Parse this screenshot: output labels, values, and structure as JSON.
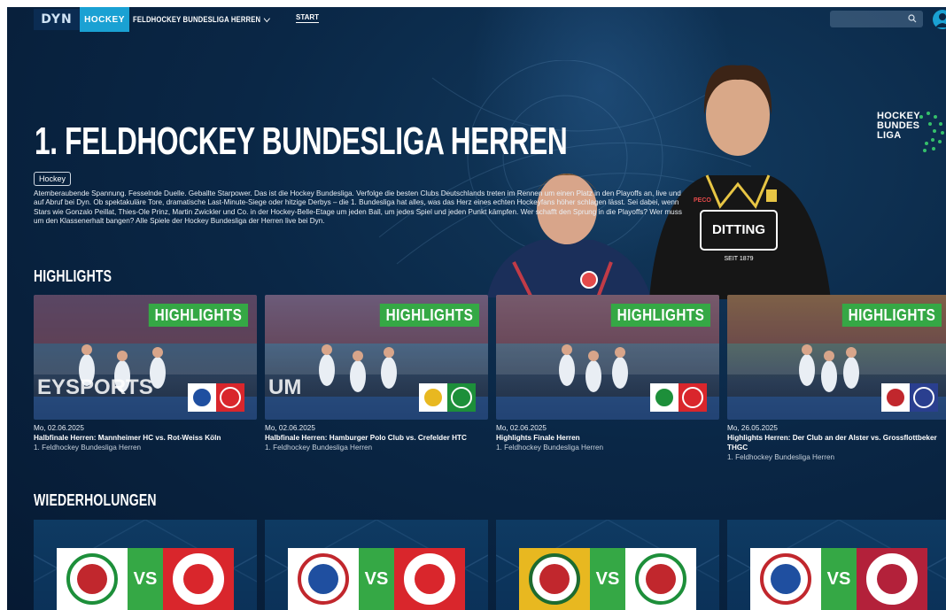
{
  "nav": {
    "logo": "DYN",
    "sport_tab": "HOCKEY",
    "league_select": "FELDHOCKEY BUNDESLIGA HERREN",
    "start_link": "START",
    "search_placeholder": ""
  },
  "hero": {
    "title": "1. FELDHOCKEY BUNDESLIGA HERREN",
    "tag": "Hockey",
    "description": "Atemberaubende Spannung. Fesselnde Duelle. Geballte Starpower. Das ist die Hockey Bundesliga. Verfolge die besten Clubs Deutschlands treten im Rennen um einen Platz in den Playoffs an, live und auf Abruf bei Dyn. Ob spektakuläre Tore, dramatische Last-Minute-Siege oder hitzige Derbys – die 1. Bundesliga hat alles, was das Herz eines echten Hockeyfans höher schlagen lässt. Sei dabei, wenn Stars wie Gonzalo Peillat, Thies-Ole Prinz, Martin Zwickler und Co. in der Hockey-Belle-Etage um jeden Ball, um jedes Spiel und jeden Punkt kämpfen. Wer schafft den Sprung in die Playoffs? Wer muss um den Klassenerhalt bangen? Alle Spiele der Hockey Bundesliga der Herren live bei Dyn.",
    "league_logo_text": [
      "HOCKEY",
      "BUNDES",
      "LIGA"
    ],
    "sponsor_text": "DITTING",
    "sponsor_sub": "SEIT 1879",
    "shirt_brand": "PECO"
  },
  "highlights": {
    "title": "HIGHLIGHTS",
    "badge": "HIGHLIGHTS",
    "items": [
      {
        "date": "Mo, 02.06.2025",
        "title": "Halbfinale Herren: Mannheimer HC vs. Rot-Weiss Köln",
        "subtitle": "1. Feldhockey Bundesliga Herren",
        "bg": "#1f4d7a",
        "crest_left": "#1f4fa0",
        "crest_right": "#d9262c",
        "watermark": "EYSPORTS"
      },
      {
        "date": "Mo, 02.06.2025",
        "title": "Halbfinale Herren: Hamburger Polo Club vs. Crefelder HTC",
        "subtitle": "1. Feldhockey Bundesliga Herren",
        "bg": "#3a6c9a",
        "crest_left": "#e8b820",
        "crest_right": "#1d8f3a",
        "watermark": "UM"
      },
      {
        "date": "Mo, 02.06.2025",
        "title": "Highlights Finale Herren",
        "subtitle": "1. Feldhockey Bundesliga Herren",
        "bg": "#4b6a86",
        "crest_left": "#1d8f3a",
        "crest_right": "#d9262c",
        "watermark": ""
      },
      {
        "date": "Mo, 26.05.2025",
        "title": "Highlights Herren: Der Club an der Alster vs. Grossflottbeker THGC",
        "subtitle": "1. Feldhockey Bundesliga Herren",
        "bg": "#56744e",
        "crest_left": "#c1272d",
        "crest_right": "#2a3f8f",
        "watermark": ""
      }
    ]
  },
  "replays": {
    "title": "WIEDERHOLUNGEN",
    "vs_label": "VS",
    "items": [
      {
        "left_bg": "#ffffff",
        "left_ring": "#1d8f3a",
        "left_inner": "#c1272d",
        "right_bg": "#d9262c",
        "right_ring": "#ffffff",
        "right_inner": "#d9262c"
      },
      {
        "left_bg": "#ffffff",
        "left_ring": "#c1272d",
        "left_inner": "#1f4fa0",
        "right_bg": "#d9262c",
        "right_ring": "#ffffff",
        "right_inner": "#d9262c"
      },
      {
        "left_bg": "#e8b820",
        "left_ring": "#1d6b2f",
        "left_inner": "#c1272d",
        "right_bg": "#ffffff",
        "right_ring": "#1d8f3a",
        "right_inner": "#c1272d"
      },
      {
        "left_bg": "#ffffff",
        "left_ring": "#c1272d",
        "left_inner": "#1f4fa0",
        "right_bg": "#b3213a",
        "right_ring": "#ffffff",
        "right_inner": "#b3213a"
      }
    ]
  },
  "colors": {
    "accent": "#1aa1d3",
    "highlight_green": "#35a845",
    "background": "#0a2746"
  }
}
